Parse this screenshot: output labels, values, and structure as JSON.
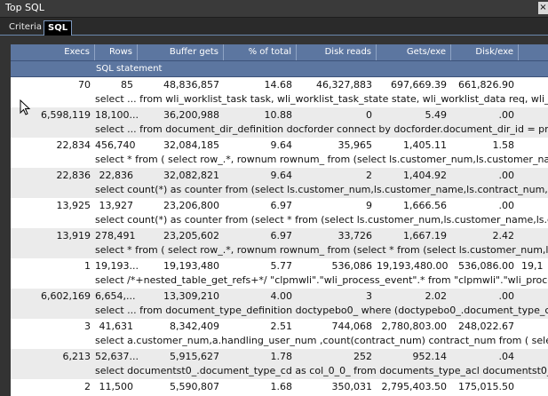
{
  "window": {
    "title": "Top SQL",
    "close_glyph": "×"
  },
  "tabs": [
    {
      "label": "Criteria"
    },
    {
      "label": "SQL"
    }
  ],
  "columns": [
    "Execs",
    "Rows",
    "Buffer gets",
    "% of total",
    "Disk reads",
    "Gets/exe",
    "Disk/exe"
  ],
  "sql_header": "SQL statement",
  "rows": [
    {
      "execs": "70",
      "rows": "85",
      "buffer_gets": "48,836,857",
      "pct": "14.68",
      "disk_reads": "46,327,883",
      "gets_exe": "697,669.39",
      "disk_exe": "661,826.90",
      "extra": "",
      "sql": "select ... from wli_worklist_task task, wli_worklist_task_state state, wli_worklist_data req, wli_worklist_"
    },
    {
      "execs": "6,598,119",
      "rows": "18,100...",
      "buffer_gets": "36,200,988",
      "pct": "10.88",
      "disk_reads": "0",
      "gets_exe": "5.49",
      "disk_exe": ".00",
      "extra": "",
      "sql": "select ... from document_dir_definition docforder connect by docforder.document_dir_id = prior docfo"
    },
    {
      "execs": "22,834",
      "rows": "456,740",
      "buffer_gets": "32,084,185",
      "pct": "9.64",
      "disk_reads": "35,965",
      "gets_exe": "1,405.11",
      "disk_exe": "1.58",
      "extra": "",
      "sql": "select * from ( select row_.*, rownum rownum_ from (select ls.customer_num,ls.customer_name,ls.co"
    },
    {
      "execs": "22,836",
      "rows": "22,836",
      "buffer_gets": "32,082,821",
      "pct": "9.64",
      "disk_reads": "2",
      "gets_exe": "1,404.92",
      "disk_exe": ".00",
      "extra": "",
      "sql": "select count(*) as counter from (select ls.customer_num,ls.customer_name,ls.contract_num, case whe"
    },
    {
      "execs": "13,925",
      "rows": "13,927",
      "buffer_gets": "23,206,800",
      "pct": "6.97",
      "disk_reads": "9",
      "gets_exe": "1,666.56",
      "disk_exe": ".00",
      "extra": "",
      "sql": "select count(*) as counter from (select * from (select ls.customer_num,ls.customer_name,ls.contract_"
    },
    {
      "execs": "13,919",
      "rows": "278,491",
      "buffer_gets": "23,205,602",
      "pct": "6.97",
      "disk_reads": "33,726",
      "gets_exe": "1,667.19",
      "disk_exe": "2.42",
      "extra": "",
      "sql": "select * from ( select row_.*, rownum rownum_ from (select * from (select ls.customer_num,ls.custome"
    },
    {
      "execs": "1",
      "rows": "19,193...",
      "buffer_gets": "19,193,480",
      "pct": "5.77",
      "disk_reads": "536,086",
      "gets_exe": "19,193,480.00",
      "disk_exe": "536,086.00",
      "extra": "19,1",
      "sql": "select /*+nested_table_get_refs+*/ \"clpmwli\".\"wli_process_event\".* from \"clpmwli\".\"wli_process_even"
    },
    {
      "execs": "6,602,169",
      "rows": "6,654,...",
      "buffer_gets": "13,309,210",
      "pct": "4.00",
      "disk_reads": "3",
      "gets_exe": "2.02",
      "disk_exe": ".00",
      "extra": "",
      "sql": "select ... from document_type_definition doctypebo0_ where (doctypebo0_.document_type_cd=:1 )"
    },
    {
      "execs": "3",
      "rows": "41,631",
      "buffer_gets": "8,342,409",
      "pct": "2.51",
      "disk_reads": "744,068",
      "gets_exe": "2,780,803.00",
      "disk_exe": "248,022.67",
      "extra": "",
      "sql": "select a.customer_num,a.handling_user_num ,count(contract_num) contract_num from ( select ls.custo"
    },
    {
      "execs": "6,213",
      "rows": "52,637...",
      "buffer_gets": "5,915,627",
      "pct": "1.78",
      "disk_reads": "252",
      "gets_exe": "952.14",
      "disk_exe": ".04",
      "extra": "",
      "sql": "select documentst0_.document_type_cd as col_0_0_ from documents_type_acl documentst0_ where"
    },
    {
      "execs": "2",
      "rows": "11,500",
      "buffer_gets": "5,590,807",
      "pct": "1.68",
      "disk_reads": "350,031",
      "gets_exe": "2,795,403.50",
      "disk_exe": "175,015.50",
      "extra": "",
      "sql": ""
    }
  ]
}
